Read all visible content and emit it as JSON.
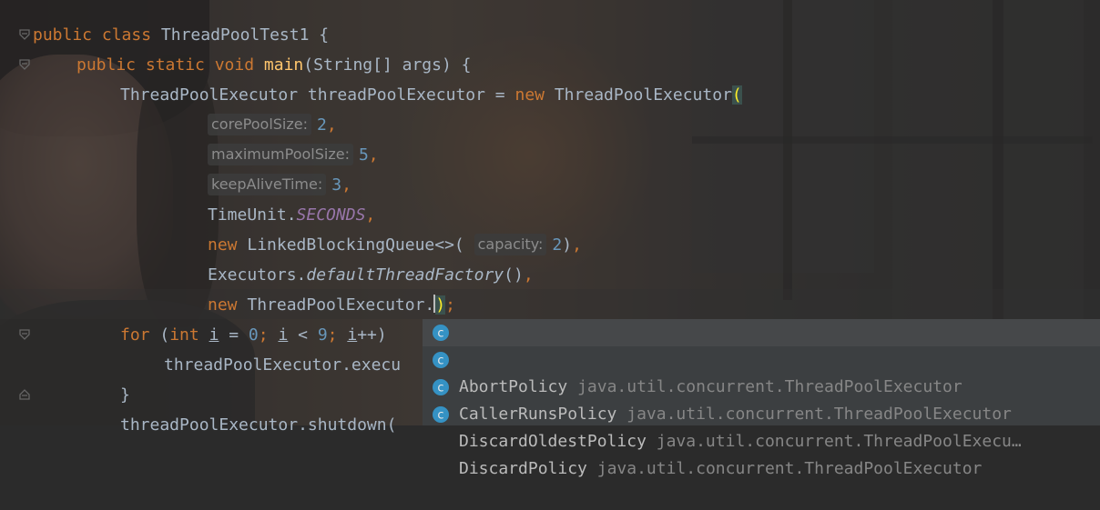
{
  "code_lines": [
    {
      "id": "l1",
      "parts": [
        [
          "kw",
          "public "
        ],
        [
          "kw",
          "class "
        ],
        [
          "cls",
          "ThreadPoolTest1 {"
        ]
      ]
    },
    {
      "id": "l2",
      "parts": [
        [
          "kw",
          "public "
        ],
        [
          "kw",
          "static "
        ],
        [
          "kw",
          "void "
        ],
        [
          "fn",
          "main"
        ],
        [
          "cls",
          "(String[] args) {"
        ]
      ]
    },
    {
      "id": "l3",
      "parts": [
        [
          "cls",
          "ThreadPoolExecutor threadPoolExecutor = "
        ],
        [
          "kw",
          "new "
        ],
        [
          "cls",
          "ThreadPoolExecutor"
        ],
        [
          "pm",
          "("
        ]
      ]
    },
    {
      "id": "l4",
      "parts": [
        [
          "hint",
          "corePoolSize:"
        ],
        [
          "num",
          "2"
        ],
        [
          "kw",
          ","
        ]
      ]
    },
    {
      "id": "l5",
      "parts": [
        [
          "hint",
          "maximumPoolSize:"
        ],
        [
          "num",
          "5"
        ],
        [
          "kw",
          ","
        ]
      ]
    },
    {
      "id": "l6",
      "parts": [
        [
          "hint",
          "keepAliveTime:"
        ],
        [
          "num",
          "3"
        ],
        [
          "kw",
          ","
        ]
      ]
    },
    {
      "id": "l7",
      "parts": [
        [
          "cls",
          "TimeUnit."
        ],
        [
          "it",
          "SECONDS"
        ],
        [
          "kw",
          ","
        ]
      ]
    },
    {
      "id": "l8",
      "parts": [
        [
          "kw",
          "new "
        ],
        [
          "cls",
          "LinkedBlockingQueue<>( "
        ],
        [
          "hint",
          "capacity:"
        ],
        [
          "num",
          "2"
        ],
        [
          "cls",
          ")"
        ],
        [
          "kw",
          ","
        ]
      ]
    },
    {
      "id": "l9",
      "parts": [
        [
          "cls",
          "Executors."
        ],
        [
          "itfn",
          "defaultThreadFactory"
        ],
        [
          "cls",
          "()"
        ],
        [
          "kw",
          ","
        ]
      ]
    },
    {
      "id": "l10",
      "parts": [
        [
          "kw",
          "new "
        ],
        [
          "cls",
          "ThreadPoolExecutor."
        ],
        [
          "cursor",
          ""
        ],
        [
          "pm",
          ")"
        ],
        [
          "kw",
          ";"
        ]
      ]
    },
    {
      "id": "l11",
      "parts": [
        [
          "kw",
          "for "
        ],
        [
          "cls",
          "("
        ],
        [
          "kw",
          "int "
        ],
        [
          "und",
          "i"
        ],
        [
          "cls",
          " = "
        ],
        [
          "num",
          "0"
        ],
        [
          "kw",
          "; "
        ],
        [
          "und",
          "i"
        ],
        [
          "cls",
          " < "
        ],
        [
          "num",
          "9"
        ],
        [
          "kw",
          "; "
        ],
        [
          "und",
          "i"
        ],
        [
          "cls",
          "++)"
        ]
      ]
    },
    {
      "id": "l12",
      "parts": [
        [
          "cls",
          "threadPoolExecutor.execu"
        ]
      ]
    },
    {
      "id": "l13",
      "parts": [
        [
          "cls",
          "}"
        ]
      ]
    },
    {
      "id": "l14",
      "parts": [
        [
          "cls",
          "threadPoolExecutor.shutdown("
        ]
      ]
    }
  ],
  "completion": {
    "items": [
      {
        "name": "AbortPolicy",
        "package": "java.util.concurrent.ThreadPoolExecutor"
      },
      {
        "name": "CallerRunsPolicy",
        "package": "java.util.concurrent.ThreadPoolExecutor"
      },
      {
        "name": "DiscardOldestPolicy",
        "package": "java.util.concurrent.ThreadPoolExecu…"
      },
      {
        "name": "DiscardPolicy",
        "package": "java.util.concurrent.ThreadPoolExecutor"
      }
    ],
    "icon_label": "c",
    "icon_color": "#3592c4"
  },
  "colors": {
    "keyword": "#cc7832",
    "number": "#6897bb",
    "function": "#ffc66d",
    "static_field": "#9876aa",
    "text": "#a9b7c6"
  }
}
